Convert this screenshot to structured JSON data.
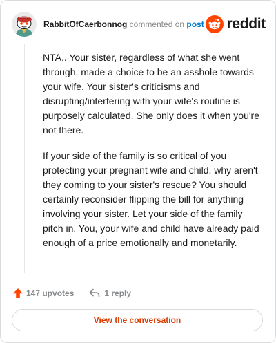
{
  "header": {
    "author": "RabbitOfCaerbonnog",
    "action_text": "commented on",
    "post_link": "post",
    "logo_text": "reddit",
    "avatar_icon": "snoo-avatar-icon",
    "logo_icon": "reddit-alien-icon"
  },
  "comment": {
    "paragraphs": [
      "NTA.. Your sister, regardless of what she went through, made a choice to be an asshole towards your wife. Your sister's criticisms and disrupting/interfering with your wife's routine is purposely calculated. She only does it when you're not there.",
      "If your side of the family is so critical of you protecting your pregnant wife and child, why aren't they coming to your sister's rescue? You should certainly reconsider flipping the bill for anything involving your sister. Let your side of the family pitch in. You, your wife and child have already paid enough of a price emotionally and monetarily."
    ]
  },
  "footer": {
    "upvotes": "147 upvotes",
    "replies": "1 reply",
    "upvote_icon": "upvote-arrow-icon",
    "reply_icon": "reply-arrow-icon"
  },
  "cta": {
    "label": "View the conversation"
  },
  "colors": {
    "brand": "#ff4500",
    "link": "#0079d3",
    "cta_text": "#d93a00",
    "muted": "#878a8c"
  }
}
